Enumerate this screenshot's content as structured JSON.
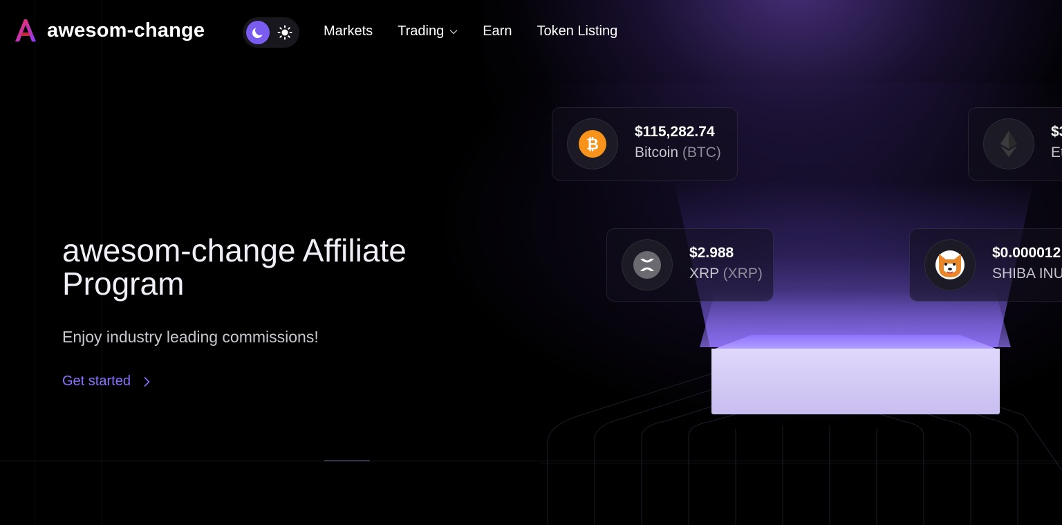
{
  "brand": {
    "name": "awesom-change",
    "logo_color": "#e0284a",
    "accent": "#7b5cf0"
  },
  "theme_toggle": {
    "active": "dark",
    "icons": [
      "moon-icon",
      "sun-icon"
    ]
  },
  "nav": {
    "markets": "Markets",
    "trading": "Trading",
    "earn": "Earn",
    "token_listing": "Token Listing"
  },
  "hero": {
    "title": "awesom-change Affiliate Program",
    "subtitle": "Enjoy industry leading commissions!",
    "cta": "Get started"
  },
  "coins": [
    {
      "price": "$115,282.74",
      "name": "Bitcoin",
      "symbol": "(BTC)",
      "icon": "bitcoin-icon",
      "color": "#f7931a"
    },
    {
      "price": "$3",
      "name": "Et",
      "symbol": "",
      "icon": "ethereum-icon",
      "color": "#3c3c3d"
    },
    {
      "price": "$2.988",
      "name": "XRP",
      "symbol": "(XRP)",
      "icon": "xrp-icon",
      "color": "#5a5a5f"
    },
    {
      "price": "$0.000012",
      "name": "SHIBA INU",
      "symbol": "",
      "icon": "shiba-inu-icon",
      "color": "#e8862a"
    }
  ]
}
